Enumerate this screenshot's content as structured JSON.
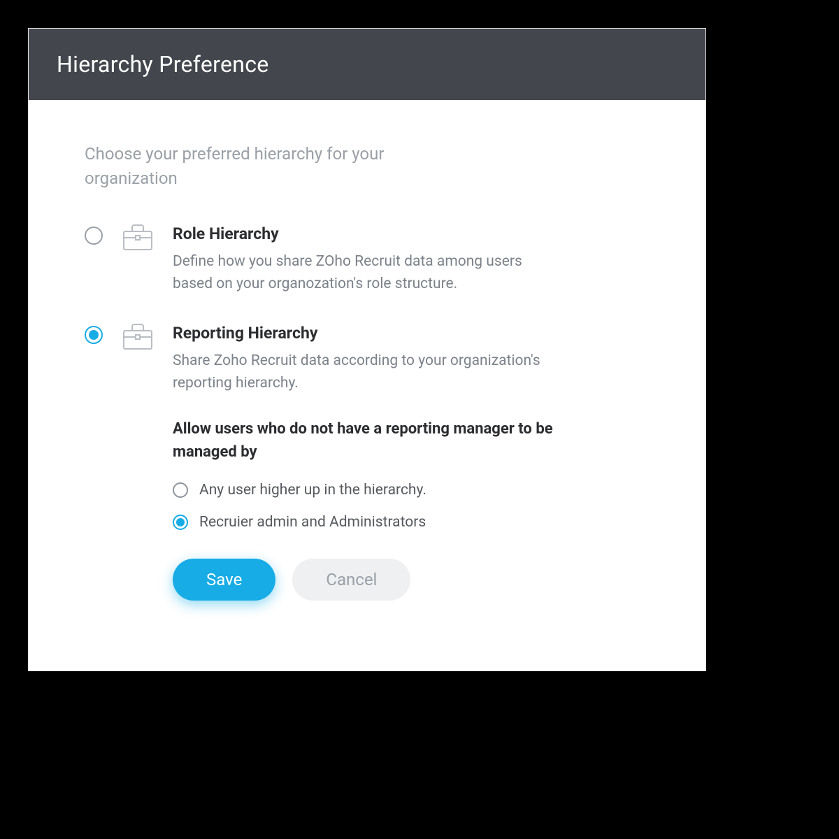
{
  "dialog": {
    "title": "Hierarchy Preference",
    "intro": "Choose your preferred hierarchy for your organization"
  },
  "options": {
    "role": {
      "title": "Role Hierarchy",
      "desc": "Define how you share ZOho Recruit data among users based on your organozation's role structure.",
      "selected": false
    },
    "reporting": {
      "title": "Reporting Hierarchy",
      "desc": "Share Zoho Recruit data according to your organization's reporting hierarchy.",
      "selected": true,
      "sub_heading": "Allow users who do not have a reporting manager to be managed by",
      "sub_options": {
        "any_higher": {
          "label": "Any user higher up in the hierarchy.",
          "selected": false
        },
        "recruiter_admin": {
          "label": "Recruier admin and Administrators",
          "selected": true
        }
      }
    }
  },
  "buttons": {
    "save": "Save",
    "cancel": "Cancel"
  },
  "colors": {
    "header_bg": "#43474d",
    "accent": "#17ace6",
    "text_muted": "#9aa0a6",
    "text_body": "#7c828a",
    "text_dark": "#2b2d30"
  }
}
